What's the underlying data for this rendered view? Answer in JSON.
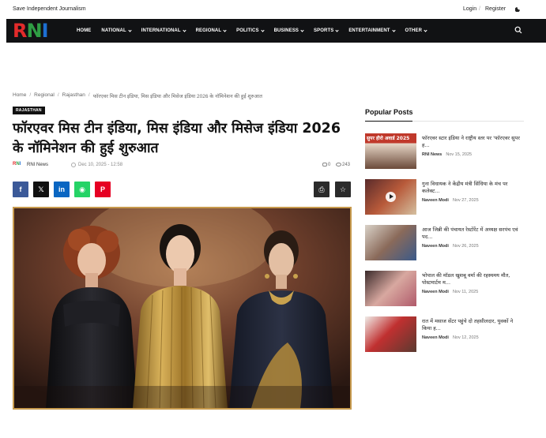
{
  "topbar": {
    "tagline": "Save Independent Journalism",
    "login": "Login",
    "separator": "/",
    "register": "Register",
    "theme_icon": "moon-icon"
  },
  "nav": {
    "logo_text": "RNI",
    "logo_colors": [
      "#e32b2b",
      "#2f9e44",
      "#1d6fd1"
    ],
    "items": [
      {
        "label": "HOME",
        "dropdown": false
      },
      {
        "label": "NATIONAL",
        "dropdown": true
      },
      {
        "label": "INTERNATIONAL",
        "dropdown": true
      },
      {
        "label": "REGIONAL",
        "dropdown": true
      },
      {
        "label": "POLITICS",
        "dropdown": true
      },
      {
        "label": "BUSINESS",
        "dropdown": true
      },
      {
        "label": "SPORTS",
        "dropdown": true
      },
      {
        "label": "ENTERTAINMENT",
        "dropdown": true
      },
      {
        "label": "OTHER",
        "dropdown": true
      }
    ],
    "search_icon": "search-icon"
  },
  "breadcrumb": {
    "items": [
      "Home",
      "Regional",
      "Rajasthan",
      "फॉरएवर मिस टीन इंडिया, मिस इंडिया और मिसेज इंडिया 2026 के नॉमिनेशन की हुई शुरुआत"
    ],
    "separator": "/"
  },
  "article": {
    "category": "RAJASTHAN",
    "title": "फॉरएवर मिस टीन इंडिया, मिस इंडिया और मिसेज इंडिया 2026 के नॉमिनेशन की हुई शुरुआत",
    "author": "RNI News",
    "date": "Dec 10, 2025 - 12:58",
    "comments": "0",
    "views": "243",
    "share_buttons": [
      {
        "network": "facebook",
        "glyph": "f",
        "color": "#3b5998"
      },
      {
        "network": "x",
        "glyph": "𝕏",
        "color": "#111111"
      },
      {
        "network": "linkedin",
        "glyph": "in",
        "color": "#0a66c2"
      },
      {
        "network": "whatsapp",
        "glyph": "◉",
        "color": "#25d366"
      },
      {
        "network": "pinterest",
        "glyph": "P",
        "color": "#e60023"
      }
    ],
    "tools": [
      {
        "name": "print",
        "glyph": "⎙"
      },
      {
        "name": "bookmark",
        "glyph": "☆"
      }
    ]
  },
  "sidebar": {
    "title": "Popular Posts",
    "posts": [
      {
        "title": "फॉरएवर स्टार इंडिया ने राष्ट्रीय स्तर पर 'फॉरएवर सुपर ह...",
        "author": "RNI News",
        "date": "Nov 15, 2025",
        "thumb_overlay": "सुपर हीरो अवार्ड 2025"
      },
      {
        "title": "गुना विधायक ने केंद्रीय मंत्री सिंधिया के मंच पर कलेक्ट...",
        "author": "Naveen Modi",
        "date": "Nov 27, 2025",
        "thumb_overlay": ""
      },
      {
        "title": "आज जिन्नी की पंचायत रेस्टोरेंट में अध्यक्ष सरपंच एवं पद...",
        "author": "Naveen Modi",
        "date": "Nov 26, 2025",
        "thumb_overlay": ""
      },
      {
        "title": "भोपाल की मॉडल खुशबू वर्मा की रहस्यमय मौत, पोस्टमार्टम म...",
        "author": "Naveen Modi",
        "date": "Nov 11, 2025",
        "thumb_overlay": ""
      },
      {
        "title": "रात में मसाज सेंटर पहुंचे दो तहसीलदार, युवकों ने किया ह...",
        "author": "Naveen Modi",
        "date": "Nov 12, 2025",
        "thumb_overlay": ""
      }
    ]
  }
}
